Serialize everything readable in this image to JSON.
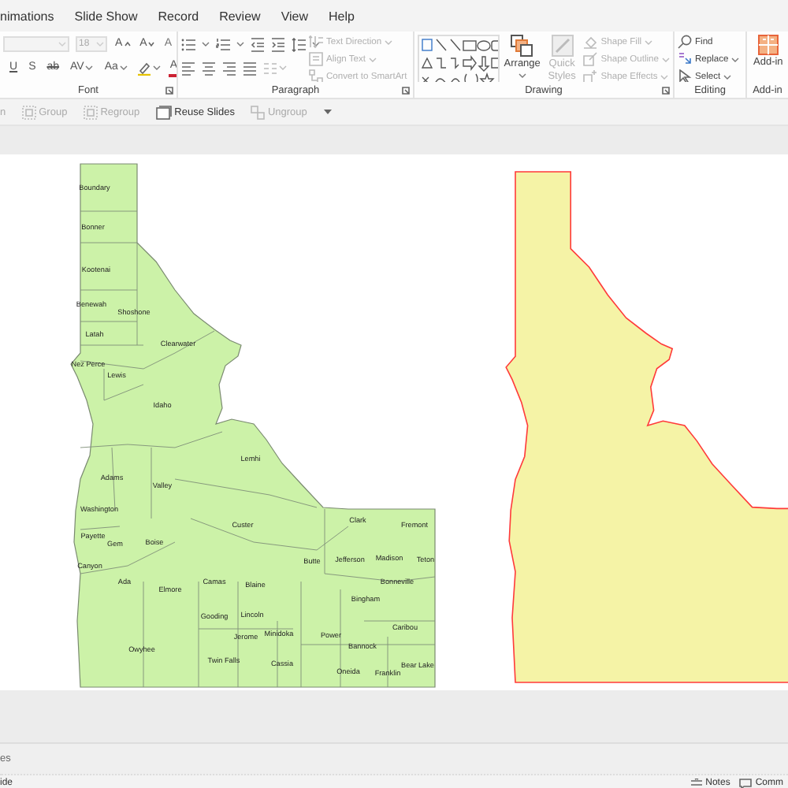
{
  "tabs": [
    {
      "label": "nimations"
    },
    {
      "label": "Slide Show"
    },
    {
      "label": "Record"
    },
    {
      "label": "Review"
    },
    {
      "label": "View"
    },
    {
      "label": "Help"
    }
  ],
  "ribbon": {
    "font": {
      "title": "Font",
      "size": "18",
      "row1": [
        {
          "kind": "grow",
          "label": "A"
        },
        {
          "kind": "shrink",
          "label": "A"
        },
        {
          "kind": "clear",
          "label": "A"
        }
      ],
      "row2": [
        {
          "kind": "underline",
          "label": "U"
        },
        {
          "kind": "plain",
          "label": "S"
        },
        {
          "kind": "strike",
          "label": "ab"
        },
        {
          "kind": "spacing",
          "label": "AV"
        },
        {
          "kind": "case",
          "label": "Aa"
        },
        {
          "kind": "highlight"
        },
        {
          "kind": "color",
          "label": "A"
        }
      ]
    },
    "paragraph": {
      "title": "Paragraph",
      "commands": [
        {
          "label": "Text Direction",
          "disabled": true,
          "dropdown": true
        },
        {
          "label": "Align Text",
          "disabled": true,
          "dropdown": true
        },
        {
          "label": "Convert to SmartArt",
          "disabled": true,
          "dropdown": false
        }
      ]
    },
    "drawing": {
      "title": "Drawing",
      "arrange": {
        "label": "Arrange",
        "disabled": false
      },
      "quick_styles": {
        "label": "Quick Styles",
        "disabled": true
      },
      "commands": [
        {
          "label": "Shape Fill",
          "disabled": true
        },
        {
          "label": "Shape Outline",
          "disabled": true
        },
        {
          "label": "Shape Effects",
          "disabled": true
        }
      ]
    },
    "editing": {
      "title": "Editing",
      "commands": [
        {
          "kind": "find",
          "label": "Find",
          "dropdown": false
        },
        {
          "kind": "replace",
          "label": "Replace",
          "dropdown": true
        },
        {
          "kind": "select",
          "label": "Select",
          "dropdown": true
        }
      ]
    },
    "addins": {
      "title": "Add-in",
      "button": "Add-in"
    }
  },
  "quick_toolbar": [
    {
      "kind": "cut",
      "label": "n",
      "disabled": true
    },
    {
      "kind": "group",
      "label": "Group",
      "disabled": true
    },
    {
      "kind": "regroup",
      "label": "Regroup",
      "disabled": true
    },
    {
      "kind": "reuse",
      "label": "Reuse Slides",
      "disabled": false
    },
    {
      "kind": "ungroup",
      "label": "Ungroup",
      "disabled": true
    }
  ],
  "slide": {
    "maps": [
      {
        "kind": "counties",
        "labels": [
          "Boundary",
          "Bonner",
          "Kootenai",
          "Benewah",
          "Shoshone",
          "Latah",
          "Clearwater",
          "Nez Perce",
          "Lewis",
          "Idaho",
          "Lemhi",
          "Adams",
          "Valley",
          "Washington",
          "Custer",
          "Clark",
          "Fremont",
          "Payette",
          "Gem",
          "Boise",
          "Canyon",
          "Butte",
          "Jefferson",
          "Madison",
          "Teton",
          "Ada",
          "Elmore",
          "Camas",
          "Blaine",
          "Bonneville",
          "Bingham",
          "Gooding",
          "Lincoln",
          "Jerome",
          "Minidoka",
          "Power",
          "Caribou",
          "Owyhee",
          "Bannock",
          "Twin Falls",
          "Cassia",
          "Oneida",
          "Franklin",
          "Bear Lake"
        ]
      },
      {
        "kind": "outline"
      }
    ]
  },
  "notes_pane": {
    "text": "es"
  },
  "status_bar": {
    "left": "ide",
    "notes": "Notes",
    "comments": "Comm"
  }
}
